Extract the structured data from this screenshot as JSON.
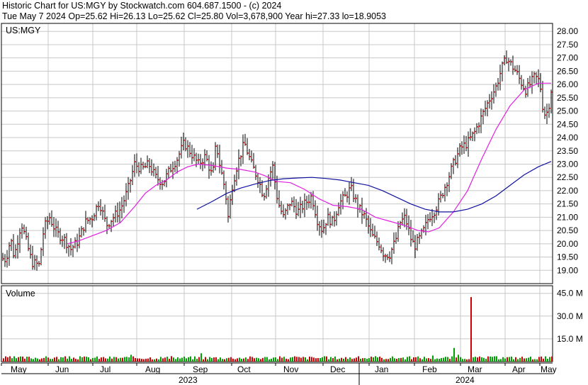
{
  "header": {
    "line1": "Historic Chart for US:MGY by Stockwatch.com 604.687.1500 - (c) 2024",
    "line2": "Tue May  7 2024   Op=25.62  Hi=26.13  Lo=25.62  Cl=25.80  Vol=3,678,900  Year hi=27.33  lo=18.9053"
  },
  "colors": {
    "background": "#ffffff",
    "grid": "#c8c8c8",
    "border": "#000000",
    "price_bar": "#000000",
    "price_up_tick": "#cc0000",
    "ma_short": "#e020e0",
    "ma_long": "#1010a0",
    "volume_up": "#00a000",
    "volume_down": "#cc0000"
  },
  "chart_data": [
    {
      "type": "ohlc",
      "label": "US:MGY",
      "ylim": [
        18.5,
        28.3
      ],
      "y_ticks": [
        "19.00",
        "19.50",
        "20.00",
        "20.50",
        "21.00",
        "21.50",
        "22.00",
        "22.50",
        "23.00",
        "23.50",
        "24.00",
        "24.50",
        "25.00",
        "25.50",
        "26.00",
        "26.50",
        "27.00",
        "27.50",
        "28.00"
      ],
      "months": [
        "May",
        "Jun",
        "Jul",
        "Aug",
        "Sep",
        "Oct",
        "Nov",
        "Dec",
        "Jan",
        "Feb",
        "Mar",
        "Apr",
        "May"
      ],
      "years": [
        "2023",
        "2024"
      ],
      "anchors": [
        {
          "x": 0,
          "y": 20.0
        },
        {
          "x": 5,
          "y": 19.3
        },
        {
          "x": 10,
          "y": 19.6
        },
        {
          "x": 15,
          "y": 20.2
        },
        {
          "x": 20,
          "y": 19.5
        },
        {
          "x": 30,
          "y": 20.8
        },
        {
          "x": 38,
          "y": 20.0
        },
        {
          "x": 45,
          "y": 19.3
        },
        {
          "x": 55,
          "y": 19.2
        },
        {
          "x": 62,
          "y": 20.6
        },
        {
          "x": 70,
          "y": 21.0
        },
        {
          "x": 80,
          "y": 20.4
        },
        {
          "x": 90,
          "y": 20.2
        },
        {
          "x": 100,
          "y": 19.8
        },
        {
          "x": 110,
          "y": 20.1
        },
        {
          "x": 120,
          "y": 20.8
        },
        {
          "x": 130,
          "y": 21.0
        },
        {
          "x": 140,
          "y": 21.6
        },
        {
          "x": 150,
          "y": 20.7
        },
        {
          "x": 160,
          "y": 21.0
        },
        {
          "x": 170,
          "y": 21.3
        },
        {
          "x": 180,
          "y": 22.0
        },
        {
          "x": 190,
          "y": 23.0
        },
        {
          "x": 200,
          "y": 22.8
        },
        {
          "x": 210,
          "y": 23.0
        },
        {
          "x": 220,
          "y": 22.5
        },
        {
          "x": 230,
          "y": 22.3
        },
        {
          "x": 240,
          "y": 22.8
        },
        {
          "x": 250,
          "y": 23.2
        },
        {
          "x": 260,
          "y": 23.8
        },
        {
          "x": 270,
          "y": 23.4
        },
        {
          "x": 280,
          "y": 23.0
        },
        {
          "x": 290,
          "y": 23.3
        },
        {
          "x": 300,
          "y": 22.5
        },
        {
          "x": 305,
          "y": 23.8
        },
        {
          "x": 310,
          "y": 23.0
        },
        {
          "x": 318,
          "y": 22.0
        },
        {
          "x": 322,
          "y": 21.0
        },
        {
          "x": 328,
          "y": 22.2
        },
        {
          "x": 335,
          "y": 23.0
        },
        {
          "x": 345,
          "y": 23.8
        },
        {
          "x": 355,
          "y": 23.0
        },
        {
          "x": 365,
          "y": 22.4
        },
        {
          "x": 372,
          "y": 21.8
        },
        {
          "x": 380,
          "y": 22.6
        },
        {
          "x": 385,
          "y": 22.9
        },
        {
          "x": 392,
          "y": 21.6
        },
        {
          "x": 400,
          "y": 21.0
        },
        {
          "x": 410,
          "y": 21.6
        },
        {
          "x": 420,
          "y": 21.2
        },
        {
          "x": 430,
          "y": 21.5
        },
        {
          "x": 440,
          "y": 21.8
        },
        {
          "x": 448,
          "y": 20.9
        },
        {
          "x": 455,
          "y": 20.5
        },
        {
          "x": 462,
          "y": 21.0
        },
        {
          "x": 470,
          "y": 20.8
        },
        {
          "x": 478,
          "y": 21.5
        },
        {
          "x": 488,
          "y": 21.8
        },
        {
          "x": 495,
          "y": 22.1
        },
        {
          "x": 505,
          "y": 21.4
        },
        {
          "x": 515,
          "y": 21.0
        },
        {
          "x": 525,
          "y": 20.3
        },
        {
          "x": 535,
          "y": 20.0
        },
        {
          "x": 542,
          "y": 19.6
        },
        {
          "x": 550,
          "y": 19.6
        },
        {
          "x": 558,
          "y": 20.1
        },
        {
          "x": 565,
          "y": 20.8
        },
        {
          "x": 572,
          "y": 21.0
        },
        {
          "x": 580,
          "y": 20.2
        },
        {
          "x": 585,
          "y": 19.9
        },
        {
          "x": 592,
          "y": 20.2
        },
        {
          "x": 600,
          "y": 20.6
        },
        {
          "x": 605,
          "y": 21.0
        },
        {
          "x": 612,
          "y": 21.2
        },
        {
          "x": 620,
          "y": 21.6
        },
        {
          "x": 630,
          "y": 22.3
        },
        {
          "x": 640,
          "y": 23.0
        },
        {
          "x": 650,
          "y": 23.6
        },
        {
          "x": 660,
          "y": 23.8
        },
        {
          "x": 670,
          "y": 24.2
        },
        {
          "x": 680,
          "y": 24.8
        },
        {
          "x": 690,
          "y": 25.4
        },
        {
          "x": 700,
          "y": 25.9
        },
        {
          "x": 708,
          "y": 26.6
        },
        {
          "x": 715,
          "y": 27.0
        },
        {
          "x": 720,
          "y": 26.8
        },
        {
          "x": 728,
          "y": 26.5
        },
        {
          "x": 735,
          "y": 26.1
        },
        {
          "x": 742,
          "y": 25.8
        },
        {
          "x": 748,
          "y": 26.0
        },
        {
          "x": 755,
          "y": 26.3
        },
        {
          "x": 762,
          "y": 26.1
        },
        {
          "x": 766,
          "y": 25.2
        },
        {
          "x": 770,
          "y": 24.8
        },
        {
          "x": 774,
          "y": 25.1
        },
        {
          "x": 778,
          "y": 25.8
        }
      ],
      "series": [
        {
          "color": "#e020e0",
          "points": [
            {
              "x": 95,
              "y": 20.0
            },
            {
              "x": 110,
              "y": 20.1
            },
            {
              "x": 130,
              "y": 20.3
            },
            {
              "x": 150,
              "y": 20.5
            },
            {
              "x": 170,
              "y": 20.8
            },
            {
              "x": 190,
              "y": 21.4
            },
            {
              "x": 205,
              "y": 21.9
            },
            {
              "x": 220,
              "y": 22.2
            },
            {
              "x": 235,
              "y": 22.4
            },
            {
              "x": 250,
              "y": 22.7
            },
            {
              "x": 265,
              "y": 22.9
            },
            {
              "x": 280,
              "y": 23.0
            },
            {
              "x": 300,
              "y": 22.95
            },
            {
              "x": 320,
              "y": 22.85
            },
            {
              "x": 340,
              "y": 22.8
            },
            {
              "x": 360,
              "y": 22.7
            },
            {
              "x": 375,
              "y": 22.55
            },
            {
              "x": 390,
              "y": 22.35
            },
            {
              "x": 410,
              "y": 22.3
            },
            {
              "x": 430,
              "y": 22.05
            },
            {
              "x": 450,
              "y": 21.7
            },
            {
              "x": 470,
              "y": 21.45
            },
            {
              "x": 490,
              "y": 21.4
            },
            {
              "x": 510,
              "y": 21.3
            },
            {
              "x": 530,
              "y": 21.0
            },
            {
              "x": 550,
              "y": 20.85
            },
            {
              "x": 570,
              "y": 20.7
            },
            {
              "x": 590,
              "y": 20.5
            },
            {
              "x": 605,
              "y": 20.45
            },
            {
              "x": 620,
              "y": 20.6
            },
            {
              "x": 640,
              "y": 21.2
            },
            {
              "x": 660,
              "y": 22.0
            },
            {
              "x": 680,
              "y": 23.2
            },
            {
              "x": 700,
              "y": 24.3
            },
            {
              "x": 720,
              "y": 25.2
            },
            {
              "x": 740,
              "y": 25.8
            },
            {
              "x": 760,
              "y": 26.05
            },
            {
              "x": 778,
              "y": 26.05
            }
          ]
        },
        {
          "color": "#1010a0",
          "points": [
            {
              "x": 278,
              "y": 21.3
            },
            {
              "x": 300,
              "y": 21.6
            },
            {
              "x": 320,
              "y": 21.9
            },
            {
              "x": 340,
              "y": 22.1
            },
            {
              "x": 360,
              "y": 22.25
            },
            {
              "x": 380,
              "y": 22.38
            },
            {
              "x": 400,
              "y": 22.45
            },
            {
              "x": 420,
              "y": 22.48
            },
            {
              "x": 440,
              "y": 22.5
            },
            {
              "x": 460,
              "y": 22.46
            },
            {
              "x": 480,
              "y": 22.4
            },
            {
              "x": 500,
              "y": 22.3
            },
            {
              "x": 520,
              "y": 22.2
            },
            {
              "x": 540,
              "y": 22.0
            },
            {
              "x": 560,
              "y": 21.75
            },
            {
              "x": 580,
              "y": 21.5
            },
            {
              "x": 600,
              "y": 21.3
            },
            {
              "x": 620,
              "y": 21.2
            },
            {
              "x": 640,
              "y": 21.2
            },
            {
              "x": 660,
              "y": 21.3
            },
            {
              "x": 680,
              "y": 21.5
            },
            {
              "x": 700,
              "y": 21.8
            },
            {
              "x": 720,
              "y": 22.2
            },
            {
              "x": 740,
              "y": 22.6
            },
            {
              "x": 760,
              "y": 22.9
            },
            {
              "x": 778,
              "y": 23.1
            }
          ]
        }
      ]
    },
    {
      "type": "bar",
      "label": "Volume",
      "ylim": [
        0,
        50
      ],
      "y_ticks": [
        "15.0 M",
        "30.0 M",
        "45.0 M"
      ],
      "typical_volume_m": 2.4,
      "spikes": [
        {
          "x": 183,
          "value_m": 4.5
        },
        {
          "x": 283,
          "value_m": 5.5
        },
        {
          "x": 416,
          "value_m": 3.5
        },
        {
          "x": 610,
          "value_m": 4.0
        },
        {
          "x": 640,
          "value_m": 9.0
        },
        {
          "x": 645,
          "value_m": 4.5
        },
        {
          "x": 665,
          "value_m": 42.5
        },
        {
          "x": 700,
          "value_m": 3.5
        }
      ]
    }
  ]
}
